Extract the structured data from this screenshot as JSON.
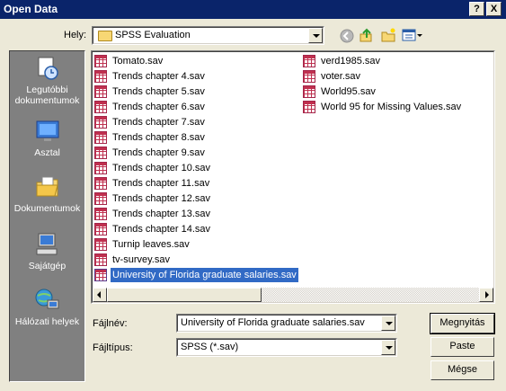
{
  "window": {
    "title": "Open Data",
    "help_button": "?",
    "close_button": "X"
  },
  "location": {
    "label": "Hely:",
    "value": "SPSS Evaluation"
  },
  "places": [
    {
      "label_line1": "Legutóbbi",
      "label_line2": "dokumentumok",
      "icon": "recent-documents-icon"
    },
    {
      "label_line1": "Asztal",
      "label_line2": "",
      "icon": "desktop-icon"
    },
    {
      "label_line1": "Dokumentumok",
      "label_line2": "",
      "icon": "my-documents-icon"
    },
    {
      "label_line1": "Sajátgép",
      "label_line2": "",
      "icon": "my-computer-icon"
    },
    {
      "label_line1": "Hálózati helyek",
      "label_line2": "",
      "icon": "network-places-icon"
    }
  ],
  "files_col1": [
    "Tomato.sav",
    "Trends chapter 4.sav",
    "Trends chapter 5.sav",
    "Trends chapter 6.sav",
    "Trends chapter 7.sav",
    "Trends chapter 8.sav",
    "Trends chapter 9.sav",
    "Trends chapter 10.sav",
    "Trends chapter 11.sav",
    "Trends chapter 12.sav",
    "Trends chapter 13.sav",
    "Trends chapter 14.sav",
    "Turnip leaves.sav",
    "tv-survey.sav",
    "University of Florida graduate salaries.sav"
  ],
  "files_col2": [
    "verd1985.sav",
    "voter.sav",
    "World95.sav",
    "World 95 for Missing Values.sav"
  ],
  "selected_file": "University of Florida graduate salaries.sav",
  "filename": {
    "label": "Fájlnév:",
    "value": "University of Florida graduate salaries.sav"
  },
  "filetype": {
    "label": "Fájltípus:",
    "value": "SPSS (*.sav)"
  },
  "buttons": {
    "open": "Megnyitás",
    "paste": "Paste",
    "cancel": "Mégse"
  },
  "colors": {
    "title_bar": "#0a246a",
    "selection": "#316ac5",
    "spss_icon": "#c0304f"
  }
}
